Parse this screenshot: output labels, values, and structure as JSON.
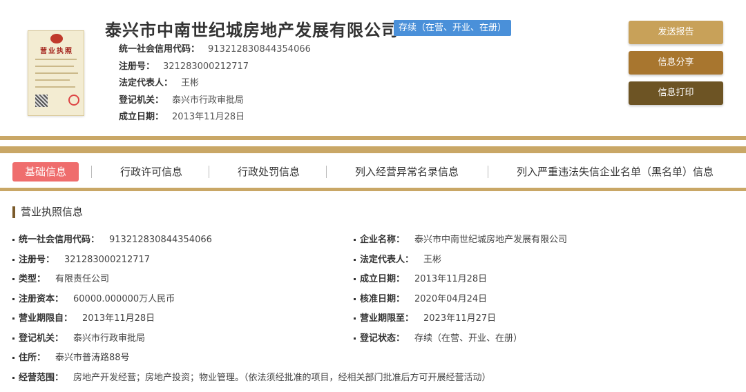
{
  "header": {
    "license_image": {
      "title": "营业执照",
      "image_caption": "business-license-thumbnail"
    },
    "company_name": "泰兴市中南世纪城房地产发展有限公司",
    "status": "存续（在营、开业、在册）",
    "fields": [
      {
        "label": "统一社会信用代码：",
        "value": "913212830844354066"
      },
      {
        "label": "注册号：",
        "value": "321283000212717"
      },
      {
        "label": "法定代表人：",
        "value": "王彬"
      },
      {
        "label": "登记机关：",
        "value": "泰兴市行政审批局"
      },
      {
        "label": "成立日期：",
        "value": "2013年11月28日"
      }
    ],
    "buttons": {
      "send_report": "发送报告",
      "share": "信息分享",
      "print": "信息打印"
    }
  },
  "tabs": [
    {
      "label": "基础信息",
      "active": true
    },
    {
      "label": "行政许可信息",
      "active": false
    },
    {
      "label": "行政处罚信息",
      "active": false
    },
    {
      "label": "列入经营异常名录信息",
      "active": false
    },
    {
      "label": "列入严重违法失信企业名单（黑名单）信息",
      "active": false
    }
  ],
  "section": {
    "title": "营业执照信息",
    "left": [
      {
        "label": "统一社会信用代码：",
        "value": "913212830844354066"
      },
      {
        "label": "注册号：",
        "value": "321283000212717"
      },
      {
        "label": "类型：",
        "value": "有限责任公司"
      },
      {
        "label": "注册资本：",
        "value": "60000.000000万人民币"
      },
      {
        "label": "营业期限自：",
        "value": "2013年11月28日"
      },
      {
        "label": "登记机关：",
        "value": "泰兴市行政审批局"
      },
      {
        "label": "住所：",
        "value": "泰兴市普涛路88号"
      },
      {
        "label": "经营范围：",
        "value": "房地产开发经营；房地产投资；物业管理。（依法须经批准的项目，经相关部门批准后方可开展经营活动）"
      }
    ],
    "right": [
      {
        "label": "企业名称：",
        "value": "泰兴市中南世纪城房地产发展有限公司"
      },
      {
        "label": "法定代表人：",
        "value": "王彬"
      },
      {
        "label": "成立日期：",
        "value": "2013年11月28日"
      },
      {
        "label": "核准日期：",
        "value": "2020年04月24日"
      },
      {
        "label": "营业期限至：",
        "value": "2023年11月27日"
      },
      {
        "label": "登记状态：",
        "value": "存续（在营、开业、在册）"
      }
    ]
  },
  "colors": {
    "gold": "#c9a766",
    "active_tab": "#ef6d6d",
    "status_badge": "#4a90d9",
    "btn_send": "#c8a159",
    "btn_share": "#a8762f",
    "btn_print": "#6d5424"
  }
}
